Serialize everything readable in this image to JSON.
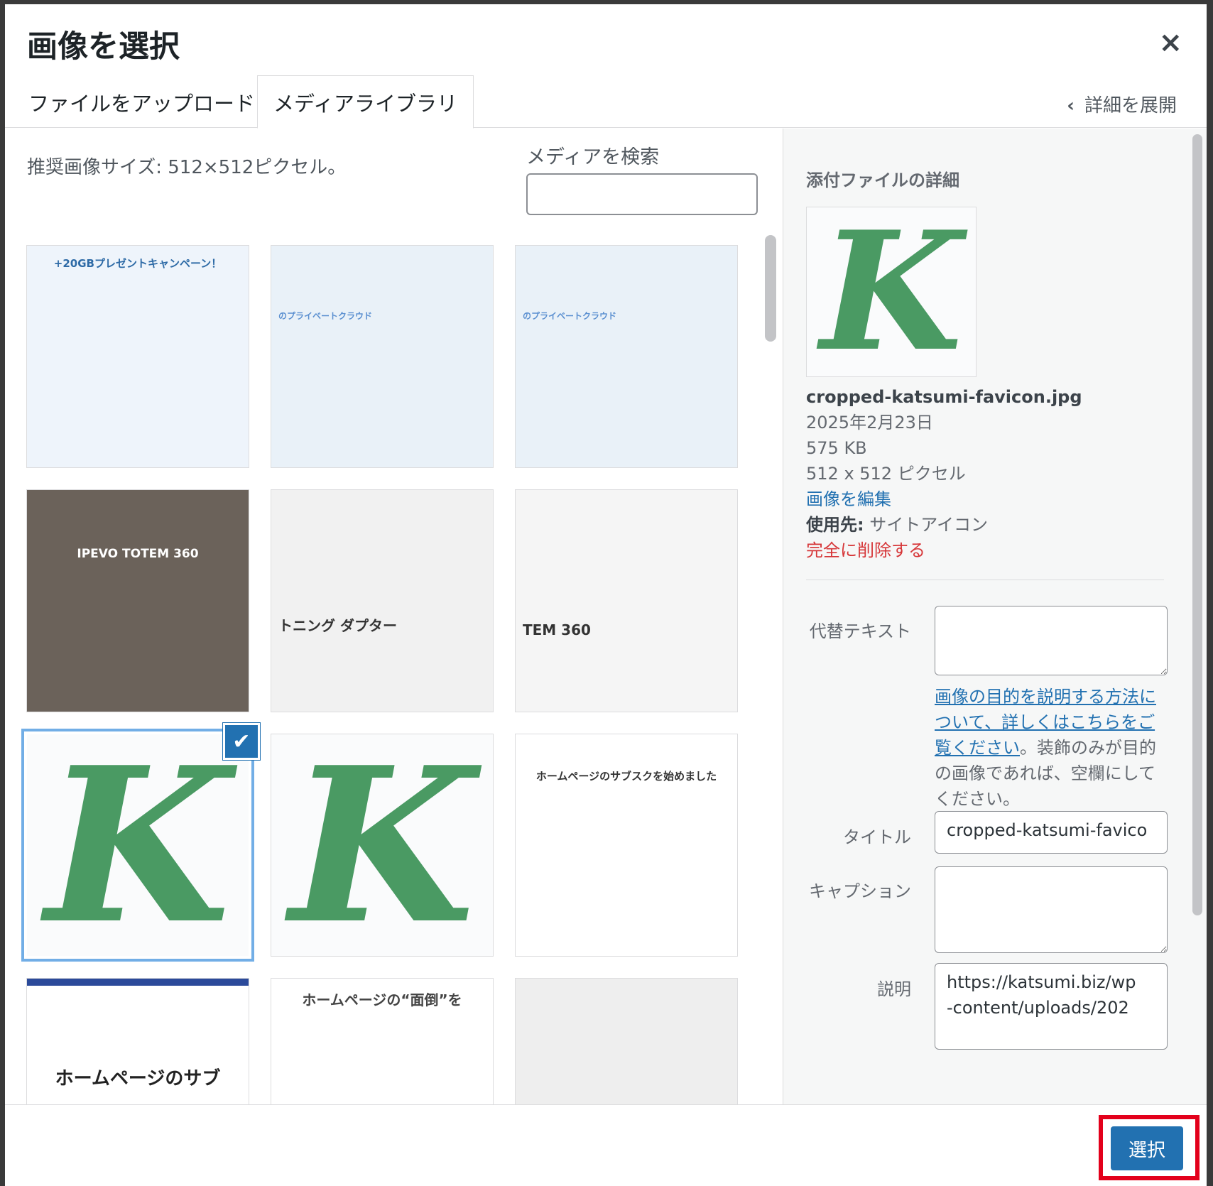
{
  "dialog": {
    "title": "画像を選択",
    "close_icon": "×",
    "tabs": {
      "upload": "ファイルをアップロード",
      "library": "メディアライブラリ"
    },
    "expand_details": "詳細を展開",
    "expand_chevron": "‹"
  },
  "library": {
    "recommended_size": "推奨画像サイズ: 512×512ピクセル。",
    "search_label": "メディアを検索",
    "search_value": "",
    "items": [
      {
        "kind": "campaign",
        "text": "+20GBプレゼントキャンペーン！"
      },
      {
        "kind": "cloud",
        "text": "のプライベートクラウド"
      },
      {
        "kind": "cloud",
        "text": "のプライベートクラウド"
      },
      {
        "kind": "meeting",
        "text": "IPEVO TOTEM 360"
      },
      {
        "kind": "adapter",
        "text": "トニング ダプター"
      },
      {
        "kind": "totem",
        "text": "TEM 360"
      },
      {
        "kind": "favicon",
        "text": "K",
        "selected": true
      },
      {
        "kind": "favicon",
        "text": "K"
      },
      {
        "kind": "subscription",
        "text": "ホームページのサブスクを始めました"
      },
      {
        "kind": "banner",
        "text": "ホームページのサブ"
      },
      {
        "kind": "subscription2",
        "text": "ホームページの“面倒”を"
      },
      {
        "kind": "gear",
        "text": ""
      }
    ],
    "check_icon": "✔"
  },
  "details": {
    "heading": "添付ファイルの詳細",
    "thumb_letter": "K",
    "filename": "cropped-katsumi-favicon.jpg",
    "date": "2025年2月23日",
    "filesize": "575 KB",
    "dimensions": "512 x 512 ピクセル",
    "edit_link": "画像を編集",
    "usage_label": "使用先:",
    "usage_value": "サイトアイコン",
    "delete_link": "完全に削除する",
    "alt_label": "代替テキスト",
    "alt_value": "",
    "help_link": "画像の目的を説明する方法について、詳しくはこちらをご覧ください",
    "help_text": "。装飾のみが目的の画像であれば、空欄にしてください。",
    "title_label": "タイトル",
    "title_value": "cropped-katsumi-favico",
    "caption_label": "キャプション",
    "caption_value": "",
    "description_label": "説明",
    "description_value": "https://katsumi.biz/wp-content/uploads/202"
  },
  "footer": {
    "select_button": "選択"
  },
  "colors": {
    "accent": "#2271b1",
    "favicon_green": "#4a9a63",
    "delete_red": "#d63638",
    "highlight": "#e3001b"
  }
}
